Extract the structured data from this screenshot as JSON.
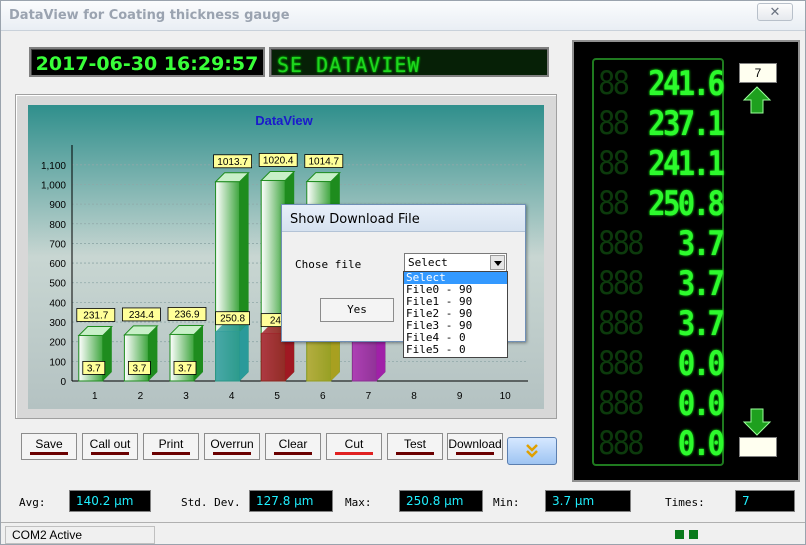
{
  "window": {
    "title": "DataView for Coating thickness gauge",
    "close_glyph": "✕"
  },
  "header": {
    "datetime": "2017-06-30 16:29:57",
    "ticker": "SE DATAVIEW"
  },
  "chart_data": {
    "type": "bar",
    "title": "DataView",
    "categories": [
      "1",
      "2",
      "3",
      "4",
      "5",
      "6",
      "7",
      "8",
      "9",
      "10"
    ],
    "yticks": [
      "0",
      "100",
      "200",
      "300",
      "400",
      "500",
      "600",
      "700",
      "800",
      "900",
      "1,000",
      "1,100"
    ],
    "ylim": [
      0,
      1150
    ],
    "series": [
      {
        "values": [
          231.7,
          234.4,
          236.9,
          1013.7,
          1020.4,
          1014.7,
          237.1,
          null,
          null,
          null
        ],
        "labels": [
          "231.7",
          "234.4",
          "236.9",
          "1013.7",
          "1020.4",
          "1014.7",
          "",
          "",
          "",
          ""
        ]
      },
      {
        "values": [
          3.7,
          3.7,
          3.7,
          250.8,
          241.1,
          237.1,
          241.6,
          null,
          null,
          null
        ],
        "labels": [
          "3.7",
          "3.7",
          "3.7",
          "250.8",
          "241",
          "",
          "",
          "",
          "",
          ""
        ]
      }
    ],
    "colors": [
      "#1e8c1e",
      "#1e8c1e",
      "#1e8c1e",
      "#1e8c1e",
      "#1e8c1e",
      "#1e8c1e",
      "#1e8c1e"
    ],
    "lower_colors": [
      "#1e8c1e",
      "#1e8c1e",
      "#1e8c1e",
      "#2a9a9a",
      "#a01822",
      "#a8a020",
      "#a020a8"
    ],
    "grid": true
  },
  "toolbar": {
    "save": "Save",
    "call_out": "Call out",
    "print": "Print",
    "overrun": "Overrun",
    "clear": "Clear",
    "cut": "Cut",
    "test": "Test",
    "download": "Download"
  },
  "stats": {
    "avg_label": "Avg:",
    "avg": "140.2 µm",
    "std_label": "Std. Dev.",
    "std": "127.8 µm",
    "max_label": "Max:",
    "max": "250.8 µm",
    "min_label": "Min:",
    "min": "3.7 µm",
    "times_label": "Times:",
    "times": "7"
  },
  "readings": {
    "count": "7",
    "rows": [
      {
        "ghost": "88",
        "value": "241.6"
      },
      {
        "ghost": "88",
        "value": "237.1"
      },
      {
        "ghost": "88",
        "value": "241.1"
      },
      {
        "ghost": "88",
        "value": "250.8"
      },
      {
        "ghost": "888",
        "value": "3.7"
      },
      {
        "ghost": "888",
        "value": "3.7"
      },
      {
        "ghost": "888",
        "value": "3.7"
      },
      {
        "ghost": "888",
        "value": "0.0"
      },
      {
        "ghost": "888",
        "value": "0.0"
      },
      {
        "ghost": "888",
        "value": "0.0"
      }
    ]
  },
  "dialog": {
    "title": "Show Download File",
    "label": "Chose file",
    "selected": "Select",
    "yes": "Yes",
    "options": [
      "Select",
      "File0 - 90",
      "File1 - 90",
      "File2 - 90",
      "File3 - 90",
      "File4 - 0",
      "File5 - 0"
    ]
  },
  "status": {
    "text": "COM2 Active"
  }
}
